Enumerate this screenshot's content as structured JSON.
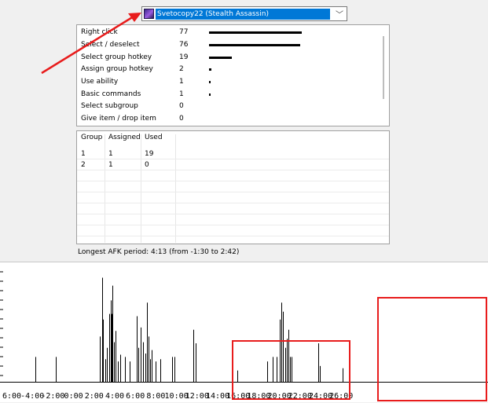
{
  "player_select": {
    "selected": "Svetocopy22 (Stealth Assassin)",
    "chevron": "﹀"
  },
  "actions": [
    {
      "label": "Right click",
      "count": "77",
      "value": 77
    },
    {
      "label": "Select / deselect",
      "count": "76",
      "value": 76
    },
    {
      "label": "Select group hotkey",
      "count": "19",
      "value": 19
    },
    {
      "label": "Assign group hotkey",
      "count": "2",
      "value": 2
    },
    {
      "label": "Use ability",
      "count": "1",
      "value": 1
    },
    {
      "label": "Basic commands",
      "count": "1",
      "value": 1
    },
    {
      "label": "Select subgroup",
      "count": "0",
      "value": 0
    },
    {
      "label": "Give item / drop item",
      "count": "0",
      "value": 0
    }
  ],
  "groups": {
    "headers": [
      "Group",
      "Assigned",
      "Used"
    ],
    "rows": [
      [
        "1",
        "1",
        "19"
      ],
      [
        "2",
        "1",
        "0"
      ]
    ]
  },
  "afk_text": "Longest AFK period: 4:13 (from -1:30 to 2:42)",
  "timeline": {
    "tick_labels": [
      "6:00",
      "-4:00",
      "-2:00",
      "0:00",
      "2:00",
      "4:00",
      "6:00",
      "8:00",
      "10:00",
      "12:00",
      "14:00",
      "16:00",
      "18:00",
      "20:00",
      "22:00",
      "24:00",
      "26:00"
    ],
    "tick_minutes": [
      -6,
      -4,
      -2,
      0,
      2,
      4,
      6,
      8,
      10,
      12,
      14,
      16,
      18,
      20,
      22,
      24,
      26
    ],
    "events": [
      {
        "t": -3.7,
        "v": 0.22
      },
      {
        "t": -1.75,
        "v": 0.22
      },
      {
        "t": 2.55,
        "v": 0.4
      },
      {
        "t": 2.75,
        "v": 0.92
      },
      {
        "t": 2.85,
        "v": 0.55
      },
      {
        "t": 3.05,
        "v": 0.2
      },
      {
        "t": 3.2,
        "v": 0.3
      },
      {
        "t": 3.45,
        "v": 0.6
      },
      {
        "t": 3.6,
        "v": 0.72
      },
      {
        "t": 3.7,
        "v": 0.6
      },
      {
        "t": 3.8,
        "v": 0.85
      },
      {
        "t": 3.95,
        "v": 0.35
      },
      {
        "t": 4.1,
        "v": 0.45
      },
      {
        "t": 4.3,
        "v": 0.18
      },
      {
        "t": 4.55,
        "v": 0.24
      },
      {
        "t": 5.0,
        "v": 0.22
      },
      {
        "t": 5.45,
        "v": 0.18
      },
      {
        "t": 6.1,
        "v": 0.58
      },
      {
        "t": 6.3,
        "v": 0.3
      },
      {
        "t": 6.55,
        "v": 0.48
      },
      {
        "t": 6.75,
        "v": 0.35
      },
      {
        "t": 7.0,
        "v": 0.25
      },
      {
        "t": 7.1,
        "v": 0.7
      },
      {
        "t": 7.3,
        "v": 0.4
      },
      {
        "t": 7.45,
        "v": 0.2
      },
      {
        "t": 7.6,
        "v": 0.28
      },
      {
        "t": 8.0,
        "v": 0.18
      },
      {
        "t": 8.45,
        "v": 0.2
      },
      {
        "t": 9.6,
        "v": 0.22
      },
      {
        "t": 9.8,
        "v": 0.22
      },
      {
        "t": 11.6,
        "v": 0.46
      },
      {
        "t": 11.9,
        "v": 0.34
      },
      {
        "t": 15.9,
        "v": 0.1
      },
      {
        "t": 18.8,
        "v": 0.18
      },
      {
        "t": 19.35,
        "v": 0.22
      },
      {
        "t": 19.7,
        "v": 0.22
      },
      {
        "t": 20.05,
        "v": 0.55
      },
      {
        "t": 20.2,
        "v": 0.7
      },
      {
        "t": 20.35,
        "v": 0.62
      },
      {
        "t": 20.55,
        "v": 0.3
      },
      {
        "t": 20.75,
        "v": 0.38
      },
      {
        "t": 20.9,
        "v": 0.46
      },
      {
        "t": 21.05,
        "v": 0.22
      },
      {
        "t": 21.2,
        "v": 0.22
      },
      {
        "t": 23.8,
        "v": 0.34
      },
      {
        "t": 23.95,
        "v": 0.14
      },
      {
        "t": 26.15,
        "v": 0.12
      }
    ],
    "highlight_color": "#e81c1c"
  },
  "annotation": {
    "arrow_color": "#e81c1c"
  }
}
